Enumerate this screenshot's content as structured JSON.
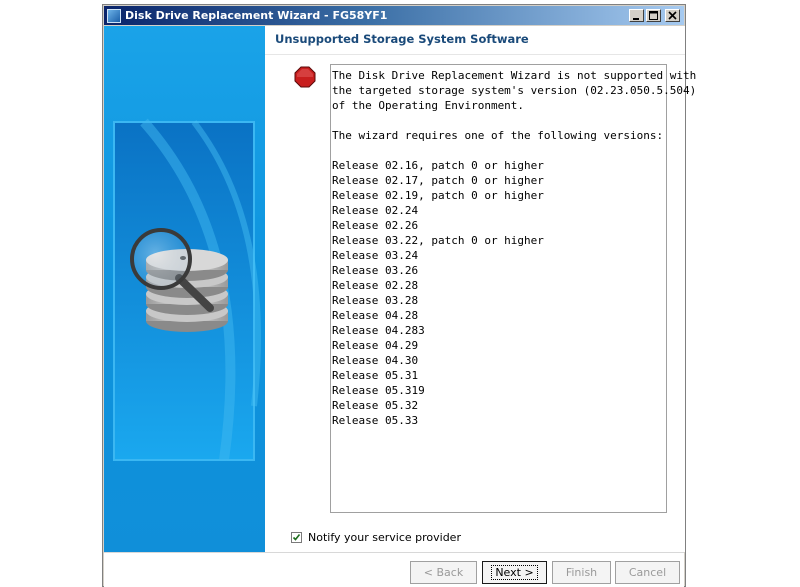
{
  "window": {
    "title": "Disk Drive Replacement Wizard - FG58YF1"
  },
  "page": {
    "heading": "Unsupported Storage System Software"
  },
  "message": {
    "lines": [
      "The Disk Drive Replacement Wizard is not supported with",
      "the targeted storage system's version (02.23.050.5.504)",
      "of the Operating Environment.",
      "",
      "The wizard requires one of the following versions:",
      "",
      "Release 02.16, patch 0 or higher",
      "Release 02.17, patch 0 or higher",
      "Release 02.19, patch 0 or higher",
      "Release 02.24",
      "Release 02.26",
      "Release 03.22, patch 0 or higher",
      "Release 03.24",
      "Release 03.26",
      "Release 02.28",
      "Release 03.28",
      "Release 04.28",
      "Release 04.283",
      "Release 04.29",
      "Release 04.30",
      "Release 05.31",
      "Release 05.319",
      "Release 05.32",
      "Release 05.33"
    ]
  },
  "notify": {
    "label": "Notify your service provider",
    "checked": true
  },
  "buttons": {
    "back": "< Back",
    "next": "Next >",
    "finish": "Finish",
    "cancel": "Cancel"
  },
  "icons": {
    "app": "wizard-app-icon",
    "status": "stop-icon",
    "side": "disk-stack-magnifier-icon"
  },
  "colors": {
    "side_panel": "#0d93de",
    "heading": "#1a4a7a",
    "stop": "#c81e1e"
  }
}
